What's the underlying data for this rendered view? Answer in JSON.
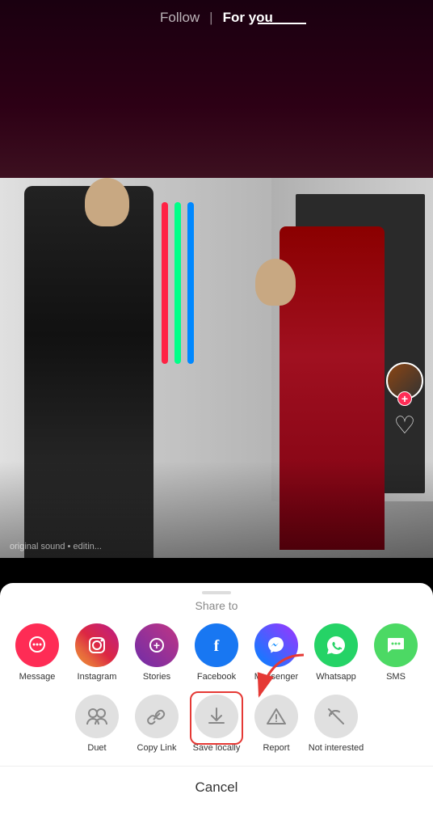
{
  "header": {
    "follow_label": "Follow",
    "divider": "|",
    "foryou_label": "For you"
  },
  "right_controls": {
    "plus_icon": "+",
    "heart_icon": "♡"
  },
  "bottom_sheet": {
    "share_to_label": "Share to",
    "row1": [
      {
        "id": "message",
        "label": "Message",
        "icon_class": "icon-message",
        "icon_symbol": "💬"
      },
      {
        "id": "instagram",
        "label": "Instagram",
        "icon_class": "icon-instagram",
        "icon_symbol": "📷"
      },
      {
        "id": "stories",
        "label": "Stories",
        "icon_class": "icon-stories",
        "icon_symbol": "➕"
      },
      {
        "id": "facebook",
        "label": "Facebook",
        "icon_class": "icon-facebook",
        "icon_symbol": "f"
      },
      {
        "id": "messenger",
        "label": "Messenger",
        "icon_class": "icon-messenger",
        "icon_symbol": "💬"
      },
      {
        "id": "whatsapp",
        "label": "Whatsapp",
        "icon_class": "icon-whatsapp",
        "icon_symbol": "📞"
      },
      {
        "id": "sms",
        "label": "SMS",
        "icon_class": "icon-sms",
        "icon_symbol": "💬"
      }
    ],
    "row2": [
      {
        "id": "duet",
        "label": "Duet",
        "icon_class": "icon-grey",
        "is_special": false
      },
      {
        "id": "copy-link",
        "label": "Copy Link",
        "icon_class": "icon-grey",
        "is_special": false
      },
      {
        "id": "save-locally",
        "label": "Save locally",
        "icon_class": "icon-grey",
        "is_special": true
      },
      {
        "id": "report",
        "label": "Report",
        "icon_class": "icon-grey",
        "is_special": false
      },
      {
        "id": "not-interested",
        "label": "Not interested",
        "icon_class": "icon-grey",
        "is_special": false
      }
    ],
    "cancel_label": "Cancel"
  },
  "rgb_colors": [
    "#ff0040",
    "#00ff88",
    "#0088ff"
  ],
  "video_info_text": "original sound • editin..."
}
